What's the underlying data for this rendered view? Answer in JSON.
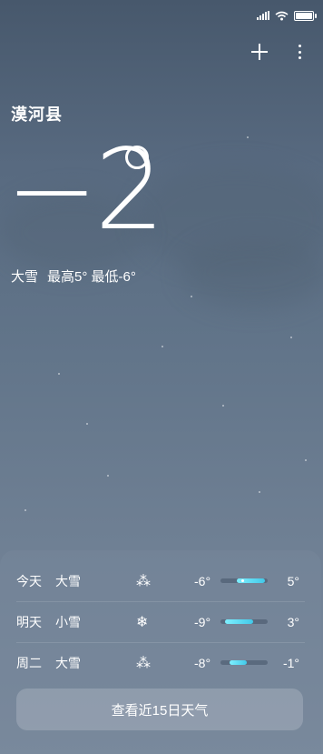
{
  "location": "漠河县",
  "current": {
    "temperature": "−2",
    "condition": "大雪",
    "high": "最高5°",
    "low": "最低-6°"
  },
  "forecast": [
    {
      "day": "今天",
      "condition": "大雪",
      "icon": "heavy-snow-icon",
      "glyph": "⁂",
      "low": "-6°",
      "high": "5°",
      "range": [
        0.35,
        0.95
      ],
      "current": 0.45
    },
    {
      "day": "明天",
      "condition": "小雪",
      "icon": "light-snow-icon",
      "glyph": "❄",
      "low": "-9°",
      "high": "3°",
      "range": [
        0.1,
        0.7
      ]
    },
    {
      "day": "周二",
      "condition": "大雪",
      "icon": "heavy-snow-icon",
      "glyph": "⁂",
      "low": "-8°",
      "high": "-1°",
      "range": [
        0.2,
        0.55
      ]
    }
  ],
  "forecast_button": "查看近15日天气",
  "colors": {
    "accent_bar": "#4fd6ef",
    "bg_top": "#47586c",
    "bg_bottom": "#7a8a9d"
  }
}
